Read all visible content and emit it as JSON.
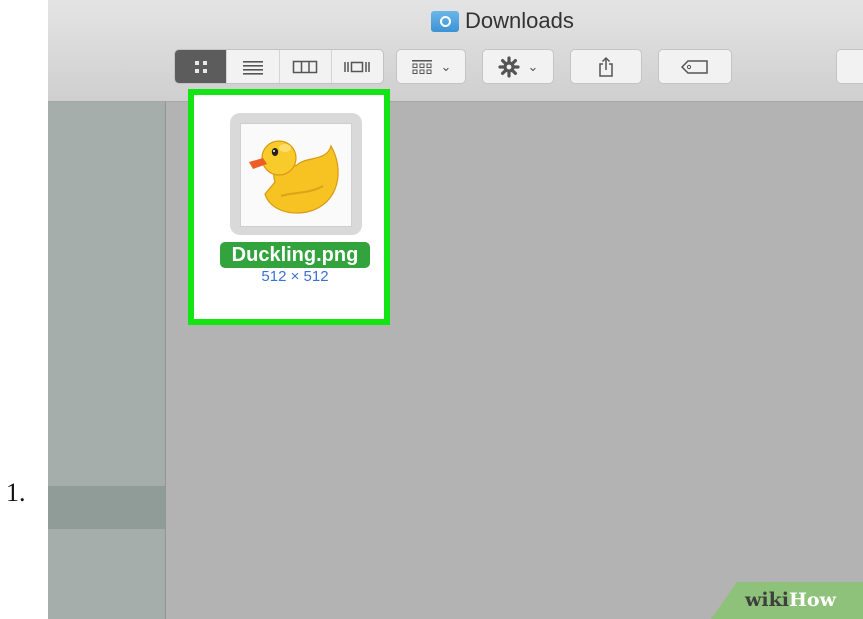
{
  "step": {
    "number": "1."
  },
  "window": {
    "title": "Downloads",
    "folder_icon": "downloads-folder-icon"
  },
  "toolbar": {
    "view_buttons": [
      {
        "name": "icon-view",
        "icon": "grid-icon",
        "active": true
      },
      {
        "name": "list-view",
        "icon": "list-icon",
        "active": false
      },
      {
        "name": "column-view",
        "icon": "columns-icon",
        "active": false
      },
      {
        "name": "cover-flow-view",
        "icon": "coverflow-icon",
        "active": false
      }
    ],
    "arrange": {
      "icon": "arrange-icon",
      "chevron": "⌄"
    },
    "action": {
      "icon": "gear-icon",
      "chevron": "⌄"
    },
    "share": {
      "icon": "share-icon"
    },
    "tags": {
      "icon": "tag-icon"
    }
  },
  "files": [
    {
      "name": "Duckling.png",
      "dimensions": "512 × 512",
      "thumbnail": "rubber-duck-thumbnail",
      "highlighted": true
    }
  ],
  "watermark": {
    "part1": "wiki",
    "part2": "How"
  },
  "colors": {
    "highlight_border": "#13e413",
    "selection_label": "#32a33d",
    "dimension_text": "#3c72d3",
    "folder_blue": "#3d93d4"
  }
}
